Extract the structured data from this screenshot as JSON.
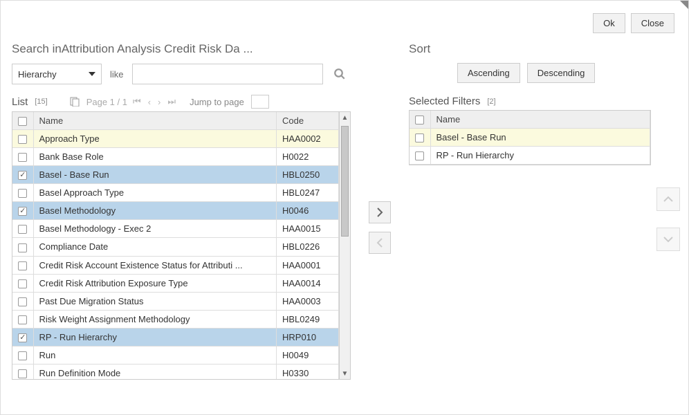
{
  "buttons": {
    "ok": "Ok",
    "close": "Close"
  },
  "search": {
    "title": "Search inAttribution Analysis Credit Risk Da ...",
    "select_value": "Hierarchy",
    "operator": "like",
    "input_value": ""
  },
  "list": {
    "title": "List",
    "count": "[15]",
    "page_label": "Page 1 / 1",
    "jump_label": "Jump to page",
    "jump_value": "",
    "columns": {
      "name": "Name",
      "code": "Code"
    },
    "rows": [
      {
        "name": "Approach Type",
        "code": "HAA0002",
        "checked": false,
        "highlight": true
      },
      {
        "name": "Bank Base Role",
        "code": "H0022",
        "checked": false
      },
      {
        "name": "Basel - Base Run",
        "code": "HBL0250",
        "checked": true,
        "selected": true
      },
      {
        "name": "Basel Approach Type",
        "code": "HBL0247",
        "checked": false
      },
      {
        "name": "Basel Methodology",
        "code": "H0046",
        "checked": true,
        "selected": true
      },
      {
        "name": "Basel Methodology - Exec 2",
        "code": "HAA0015",
        "checked": false
      },
      {
        "name": "Compliance Date",
        "code": "HBL0226",
        "checked": false
      },
      {
        "name": "Credit Risk Account Existence Status for Attributi ...",
        "code": "HAA0001",
        "checked": false
      },
      {
        "name": "Credit Risk Attribution Exposure Type",
        "code": "HAA0014",
        "checked": false
      },
      {
        "name": "Past Due Migration Status",
        "code": "HAA0003",
        "checked": false
      },
      {
        "name": "Risk Weight Assignment Methodology",
        "code": "HBL0249",
        "checked": false
      },
      {
        "name": "RP - Run Hierarchy",
        "code": "HRP010",
        "checked": true,
        "selected": true
      },
      {
        "name": "Run",
        "code": "H0049",
        "checked": false
      },
      {
        "name": "Run Definition Mode",
        "code": "H0330",
        "checked": false
      }
    ]
  },
  "sort": {
    "title": "Sort",
    "asc": "Ascending",
    "desc": "Descending"
  },
  "selected": {
    "title": "Selected Filters",
    "count": "[2]",
    "columns": {
      "name": "Name"
    },
    "rows": [
      {
        "name": "Basel - Base Run",
        "checked": false,
        "highlight": true
      },
      {
        "name": "RP - Run Hierarchy",
        "checked": false
      }
    ]
  }
}
